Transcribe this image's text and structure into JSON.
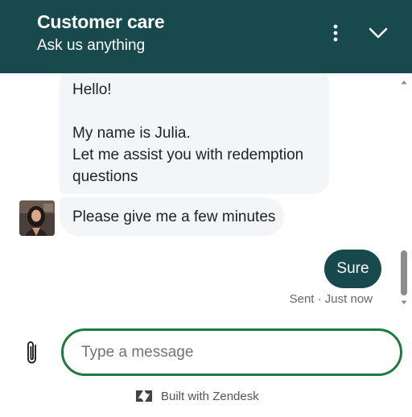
{
  "header": {
    "title": "Customer care",
    "subtitle": "Ask us anything",
    "menu_icon": "more-vertical-icon",
    "collapse_icon": "chevron-down-icon",
    "background": "#17494d"
  },
  "messages": {
    "agent_bubble_1": {
      "line1": "Hello!",
      "line2": "My name is Julia.",
      "line3": "Let me assist you with redemption",
      "line4": "questions"
    },
    "agent_bubble_2": {
      "text": "Please give me a few minutes"
    },
    "user_bubble": {
      "text": "Sure"
    },
    "receipt": "Sent · Just now"
  },
  "composer": {
    "attach_icon": "paperclip-icon",
    "placeholder": "Type a message",
    "value": "",
    "border_color": "#1f7a3e"
  },
  "footer": {
    "logo_icon": "zendesk-logo-icon",
    "text": "Built with Zendesk"
  }
}
